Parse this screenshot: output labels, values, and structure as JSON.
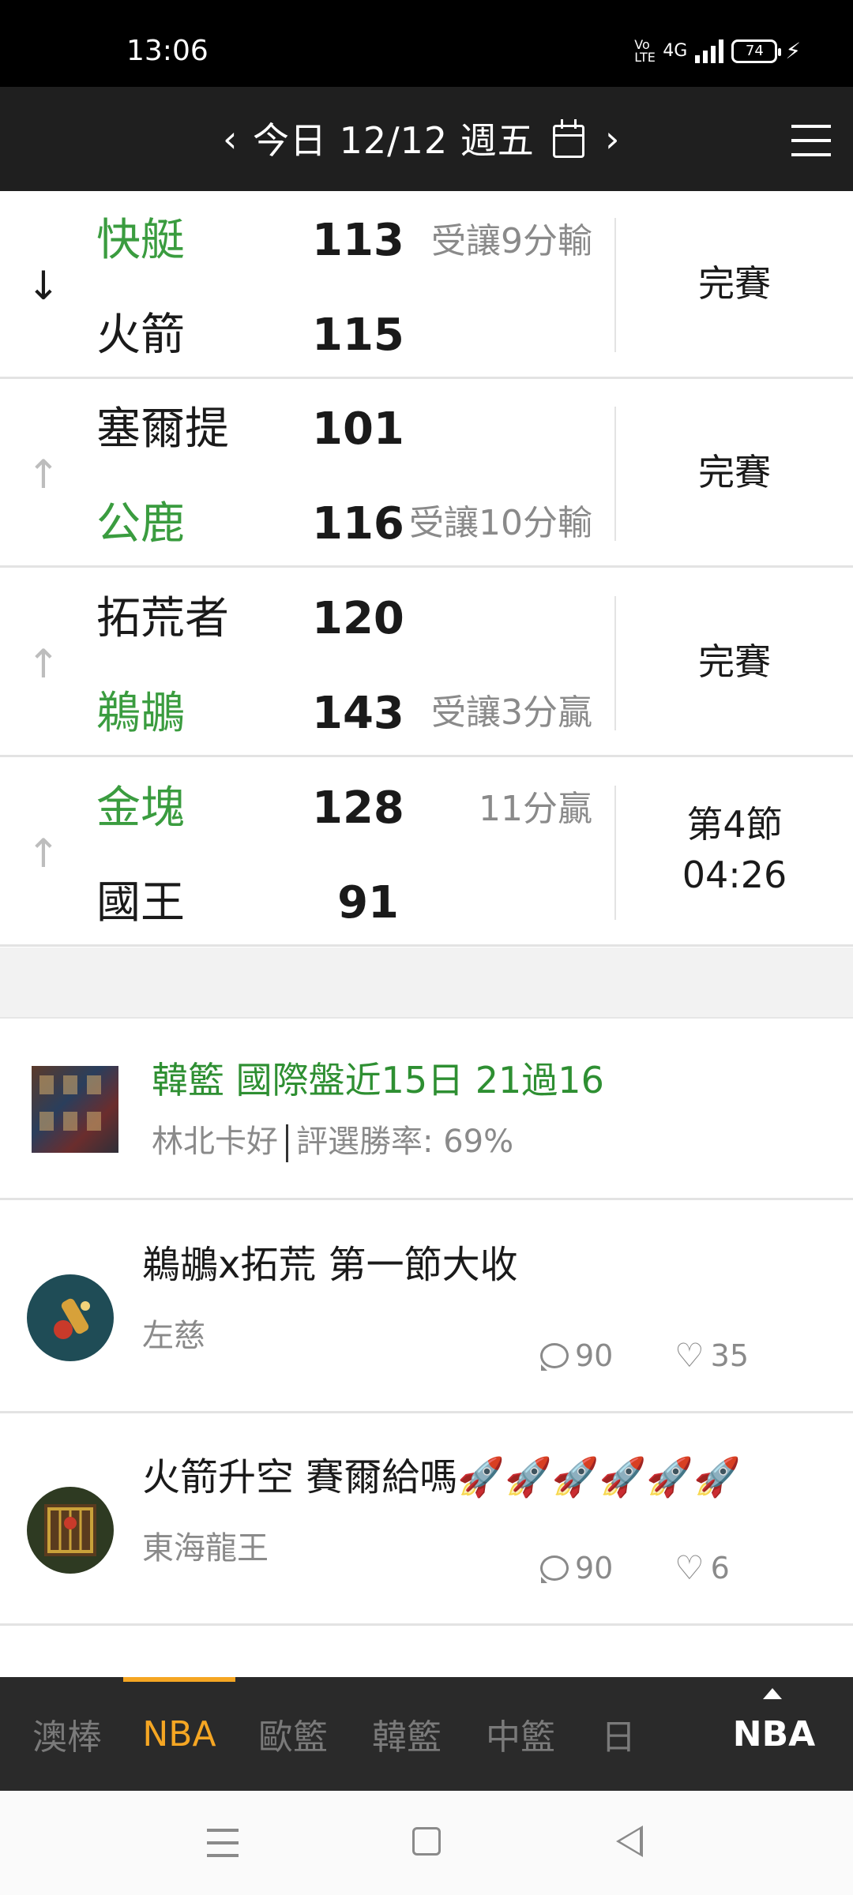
{
  "status_bar": {
    "time": "13:06",
    "network": "4G",
    "volte": "Vo LTE",
    "battery": "74"
  },
  "header": {
    "prev_icon": "chevron-left-icon",
    "date_label": "今日 12/12 週五",
    "calendar_icon": "calendar-icon",
    "next_icon": "chevron-right-icon",
    "menu_icon": "hamburger-menu-icon"
  },
  "games": [
    {
      "arrow": "↓",
      "home": {
        "name": "快艇",
        "score": "113",
        "note": "受讓9分輸",
        "color": "green"
      },
      "away": {
        "name": "火箭",
        "score": "115",
        "note": "",
        "color": "black"
      },
      "status": "完賽"
    },
    {
      "arrow": "↑",
      "home": {
        "name": "塞爾提",
        "score": "101",
        "note": "",
        "color": "black"
      },
      "away": {
        "name": "公鹿",
        "score": "116",
        "note": "受讓10分輸",
        "color": "green"
      },
      "status": "完賽"
    },
    {
      "arrow": "↑",
      "home": {
        "name": "拓荒者",
        "score": "120",
        "note": "",
        "color": "black"
      },
      "away": {
        "name": "鵜鶘",
        "score": "143",
        "note": "受讓3分贏",
        "color": "green"
      },
      "status": "完賽"
    },
    {
      "arrow": "↑",
      "home": {
        "name": "金塊",
        "score": "128",
        "note": "11分贏",
        "color": "green"
      },
      "away": {
        "name": "國王",
        "score": "91",
        "note": "",
        "color": "black"
      },
      "status_line1": "第4節",
      "status_line2": "04:26"
    }
  ],
  "expert_card": {
    "title": "韓籃 國際盤近15日 21過16",
    "author": "林北卡好",
    "rate": "評選勝率: 69%"
  },
  "posts": [
    {
      "title": "鵜鶘x拓荒 第一節大收",
      "author": "左慈",
      "comments": "90",
      "likes": "35"
    },
    {
      "title": "火箭升空 賽爾給嗎🚀🚀🚀🚀🚀🚀",
      "author": "東海龍王",
      "comments": "90",
      "likes": "6"
    }
  ],
  "bottom_nav": {
    "tabs": [
      "澳棒",
      "NBA",
      "歐籃",
      "韓籃",
      "中籃",
      "日"
    ],
    "active": "NBA",
    "current_label": "NBA"
  },
  "colors": {
    "accent": "#f5a623",
    "win_green": "#3a9c3f",
    "header_bg": "#1f1f1f"
  }
}
